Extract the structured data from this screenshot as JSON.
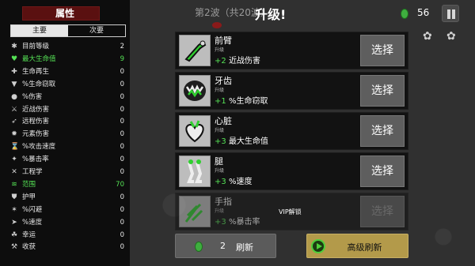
{
  "stats": {
    "title": "属性",
    "tabs": [
      {
        "label": "主要",
        "active": true
      },
      {
        "label": "次要",
        "active": false
      }
    ],
    "rows": [
      {
        "icon": "level-icon",
        "glyph": "✱",
        "label": "目前等级",
        "value": "2",
        "highlight": false
      },
      {
        "icon": "heart-icon",
        "glyph": "♥",
        "label": "最大生命值",
        "value": "9",
        "highlight": true
      },
      {
        "icon": "regen-icon",
        "glyph": "✚",
        "label": "生命再生",
        "value": "0",
        "highlight": false
      },
      {
        "icon": "fang-icon",
        "glyph": "▼",
        "label": "%生命窃取",
        "value": "0",
        "highlight": false
      },
      {
        "icon": "damage-icon",
        "glyph": "●",
        "label": "%伤害",
        "value": "0",
        "highlight": false
      },
      {
        "icon": "melee-icon",
        "glyph": "⚔",
        "label": "近战伤害",
        "value": "0",
        "highlight": false
      },
      {
        "icon": "ranged-icon",
        "glyph": "➶",
        "label": "远程伤害",
        "value": "0",
        "highlight": false
      },
      {
        "icon": "elemental-icon",
        "glyph": "✹",
        "label": "元素伤害",
        "value": "0",
        "highlight": false
      },
      {
        "icon": "attack-speed-icon",
        "glyph": "⌛",
        "label": "%攻击速度",
        "value": "0",
        "highlight": false
      },
      {
        "icon": "crit-icon",
        "glyph": "✦",
        "label": "%暴击率",
        "value": "0",
        "highlight": false
      },
      {
        "icon": "engineering-icon",
        "glyph": "✕",
        "label": "工程学",
        "value": "0",
        "highlight": false
      },
      {
        "icon": "range-icon",
        "glyph": "≋",
        "label": "范围",
        "value": "70",
        "highlight": true
      },
      {
        "icon": "armor-icon",
        "glyph": "⛊",
        "label": "护甲",
        "value": "0",
        "highlight": false
      },
      {
        "icon": "dodge-icon",
        "glyph": "✶",
        "label": "%闪避",
        "value": "0",
        "highlight": false
      },
      {
        "icon": "speed-icon",
        "glyph": "➤",
        "label": "%速度",
        "value": "0",
        "highlight": false
      },
      {
        "icon": "luck-icon",
        "glyph": "☘",
        "label": "幸运",
        "value": "0",
        "highlight": false
      },
      {
        "icon": "harvest-icon",
        "glyph": "⚒",
        "label": "收获",
        "value": "0",
        "highlight": false
      }
    ]
  },
  "header": {
    "wave_label": "第2波（共20波）",
    "levelup_title": "升级!",
    "material_count": "56"
  },
  "upgrades": [
    {
      "icon": "forearm-icon",
      "name": "前臂",
      "level": "升级",
      "bonus": "+2",
      "effect": "近战伤害",
      "button": "选择",
      "locked": false
    },
    {
      "icon": "teeth-icon",
      "name": "牙齿",
      "level": "升级",
      "bonus": "+1",
      "effect": "%生命窃取",
      "button": "选择",
      "locked": false
    },
    {
      "icon": "heart-organ-icon",
      "name": "心脏",
      "level": "升级",
      "bonus": "+3",
      "effect": "最大生命值",
      "button": "选择",
      "locked": false
    },
    {
      "icon": "legs-icon",
      "name": "腿",
      "level": "升级",
      "bonus": "+3",
      "effect": "%速度",
      "button": "选择",
      "locked": false
    },
    {
      "icon": "fingers-icon",
      "name": "手指",
      "level": "升级",
      "bonus": "+3",
      "effect": "%暴击率",
      "button": "选择",
      "locked": true
    }
  ],
  "vip_label": "VIP解锁",
  "refresh": {
    "cost": "2",
    "label": "刷新"
  },
  "advanced_refresh": {
    "label": "高级刷新"
  },
  "colors": {
    "bonus_green": "#55e255",
    "panel_bg": "#0d0d0d",
    "gold_button": "#b39a4a"
  }
}
